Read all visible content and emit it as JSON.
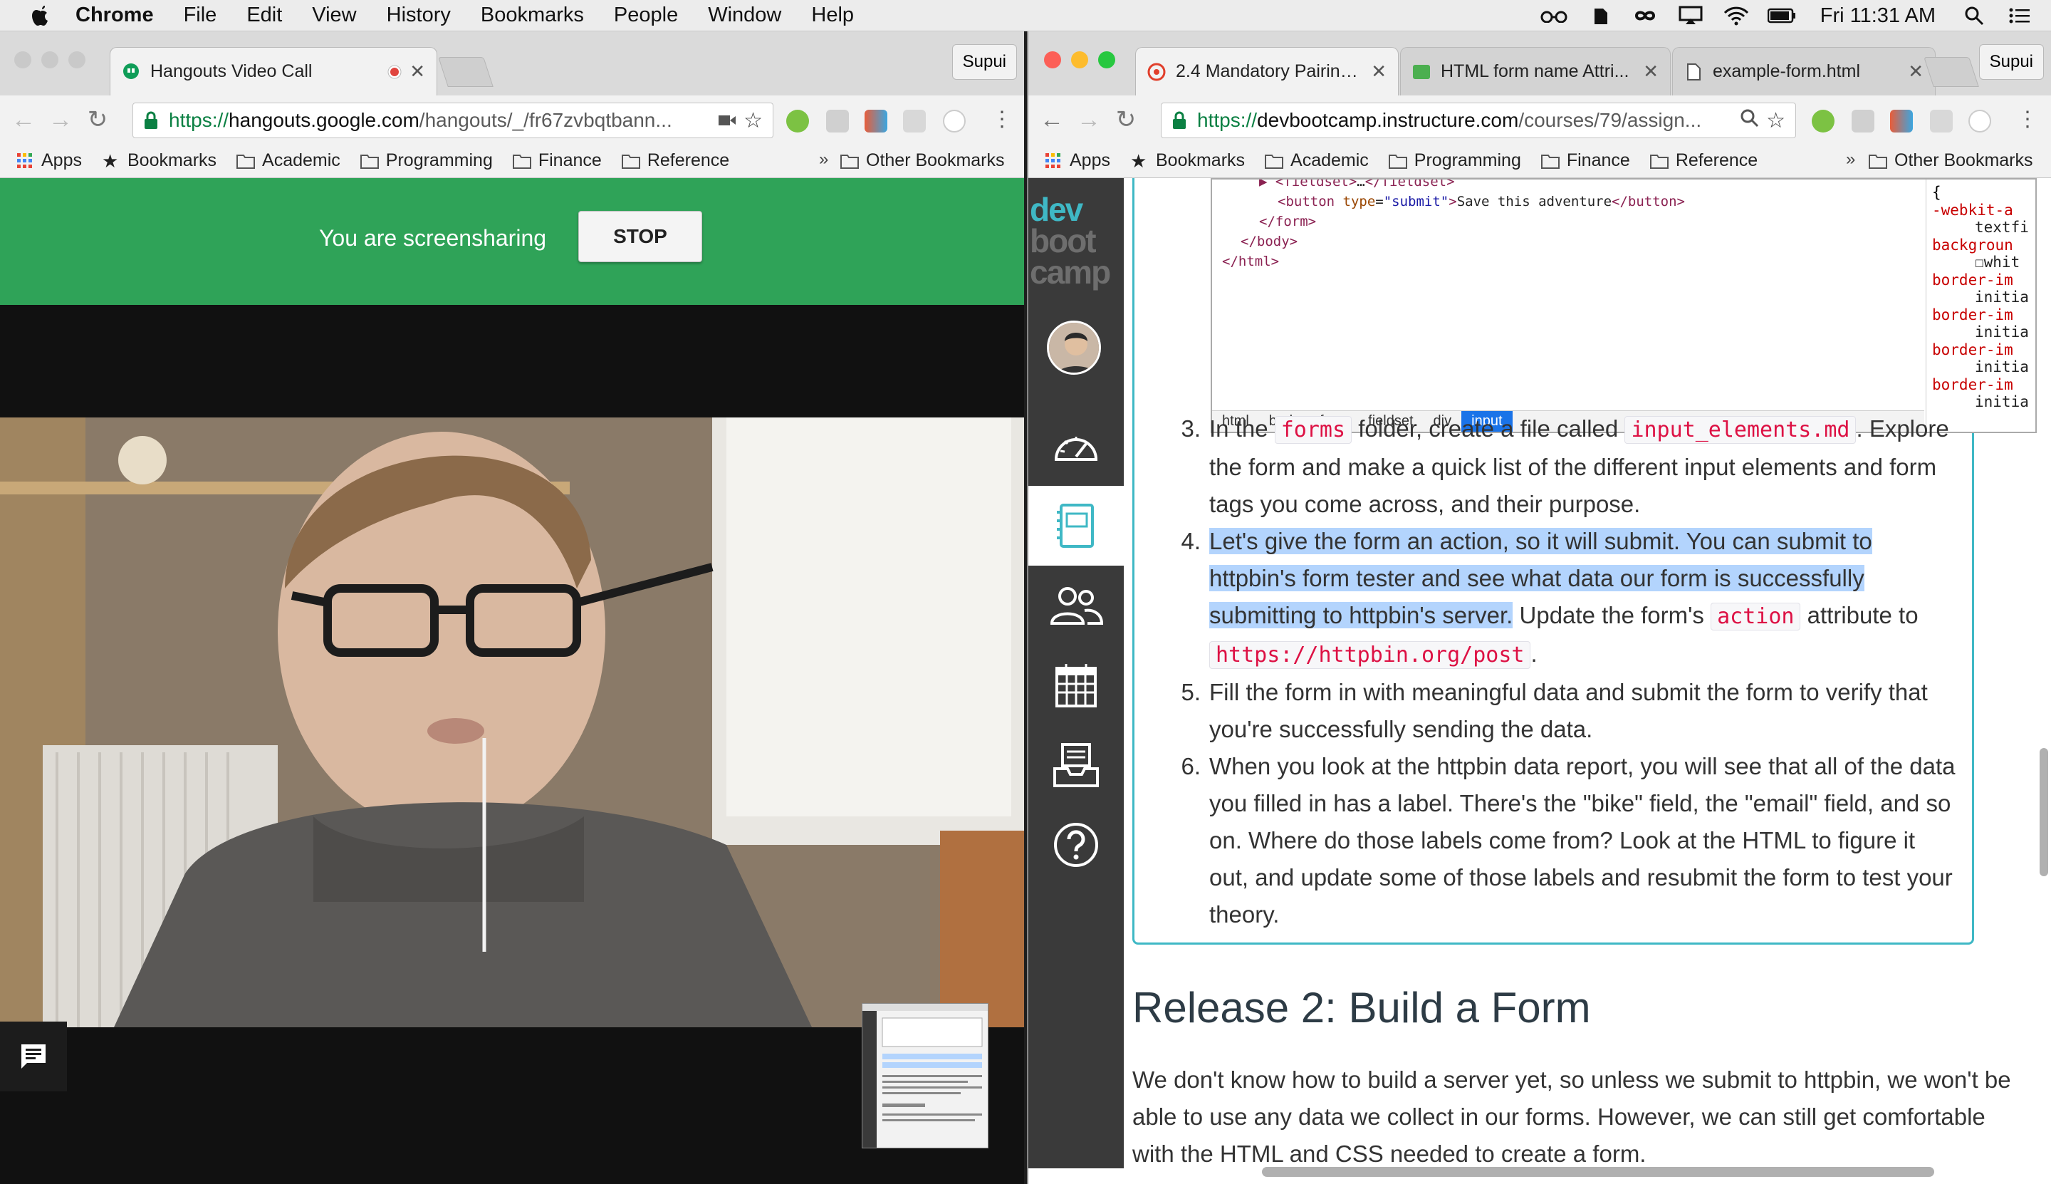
{
  "menubar": {
    "app_name": "Chrome",
    "items": [
      "File",
      "Edit",
      "View",
      "History",
      "Bookmarks",
      "People",
      "Window",
      "Help"
    ],
    "clock": "Fri 11:31 AM"
  },
  "left_window": {
    "tab": {
      "title": "Hangouts Video Call"
    },
    "profile": "Supui",
    "url_prefix": "https://",
    "url_host": "hangouts.google.com",
    "url_path": "/hangouts/_/fr67zvbqtbann...",
    "bookmarks": [
      "Apps",
      "Bookmarks",
      "Academic",
      "Programming",
      "Finance",
      "Reference"
    ],
    "other_bookmarks": "Other Bookmarks",
    "more": "»",
    "banner": {
      "message": "You are screensharing",
      "stop_label": "STOP"
    }
  },
  "right_window": {
    "tabs": [
      {
        "title": "2.4 Mandatory Pairing: ..."
      },
      {
        "title": "HTML form name Attri..."
      },
      {
        "title": "example-form.html"
      }
    ],
    "profile": "Supui",
    "url_prefix": "https://",
    "url_host": "devbootcamp.instructure.com",
    "url_path": "/courses/79/assign...",
    "bookmarks": [
      "Apps",
      "Bookmarks",
      "Academic",
      "Programming",
      "Finance",
      "Reference"
    ],
    "other_bookmarks": "Other Bookmarks",
    "more": "»",
    "logo": {
      "line1": "dev",
      "line2": "boot",
      "line3": "camp"
    },
    "nav": [
      "account",
      "dashboard",
      "courses",
      "groups",
      "calendar",
      "inbox",
      "help"
    ],
    "devtools": {
      "lines": [
        {
          "indent": 2,
          "open": "▶ <fieldset>",
          "mid": "…",
          "close": "</fieldset>"
        },
        {
          "indent": 3,
          "tag_open": "<button ",
          "attr": "type",
          "val": "\"submit\"",
          "text": "Save this adventure",
          "tag_close": "</button>"
        },
        {
          "indent": 2,
          "plain": "</form>"
        },
        {
          "indent": 1,
          "plain": "</body>"
        },
        {
          "indent": 0,
          "plain": "</html>"
        }
      ],
      "breadcrumbs": [
        "html",
        "body",
        "form",
        "fieldset",
        "div",
        "input"
      ],
      "styles": [
        {
          "t": "b",
          "text": "{"
        },
        {
          "t": "p",
          "text": "-webkit-a"
        },
        {
          "t": "v",
          "text": "textfi"
        },
        {
          "t": "p",
          "text": "backgroun"
        },
        {
          "t": "v",
          "text": "☐whit"
        },
        {
          "t": "p",
          "text": "border-im"
        },
        {
          "t": "v",
          "text": "initia"
        },
        {
          "t": "p",
          "text": "border-im"
        },
        {
          "t": "v",
          "text": "initia"
        },
        {
          "t": "p",
          "text": "border-im"
        },
        {
          "t": "v",
          "text": "initia"
        },
        {
          "t": "p",
          "text": "border-im"
        },
        {
          "t": "v",
          "text": "initia"
        }
      ]
    },
    "list": [
      {
        "num": "3.",
        "parts": [
          {
            "t": "text",
            "v": "In the "
          },
          {
            "t": "code",
            "v": "forms"
          },
          {
            "t": "text",
            "v": " folder, create a file called "
          },
          {
            "t": "code",
            "v": "input_elements.md"
          },
          {
            "t": "text",
            "v": ". Explore the form and make a quick list of the different input elements and form tags you come across, and their purpose."
          }
        ]
      },
      {
        "num": "4.",
        "parts": [
          {
            "t": "hl",
            "v": "Let's give the form an action, so it will submit. You can submit to httpbin's form tester and see what data our form is successfully submitting to httpbin's server."
          },
          {
            "t": "text",
            "v": " Update the form's "
          },
          {
            "t": "code",
            "v": "action"
          },
          {
            "t": "text",
            "v": " attribute to "
          },
          {
            "t": "code",
            "v": "https://httpbin.org/post"
          },
          {
            "t": "text",
            "v": "."
          }
        ]
      },
      {
        "num": "5.",
        "parts": [
          {
            "t": "text",
            "v": "Fill the form in with meaningful data and submit the form to verify that you're successfully sending the data."
          }
        ]
      },
      {
        "num": "6.",
        "parts": [
          {
            "t": "text",
            "v": "When you look at the httpbin data report, you will see that all of the data you filled in has a label. There's the \"bike\" field, the \"email\" field, and so on. Where do those labels come from? Look at the HTML to figure it out, and update some of those labels and resubmit the form to test your theory."
          }
        ]
      }
    ],
    "heading": "Release 2: Build a Form",
    "paragraph": "We don't know how to build a server yet, so unless we submit to httpbin, we won't be able to use any data we collect in our forms. However, we can still get comfortable with the HTML and CSS needed to create a form."
  },
  "colors": {
    "hangouts_green": "#2fa358",
    "canvas_teal": "#3fb8c5",
    "code_red": "#dd1144",
    "highlight": "#b3d4fd",
    "canvas_sidebar": "#3a3a3a"
  }
}
